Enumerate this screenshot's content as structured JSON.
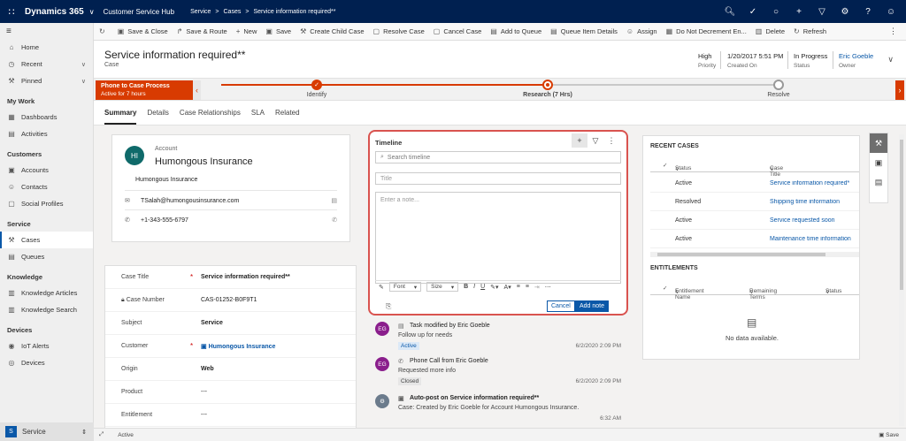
{
  "topbar": {
    "app_name": "Dynamics 365",
    "hub": "Customer Service Hub",
    "breadcrumb": [
      "Service",
      ">",
      "Cases",
      ">",
      "Service information required**"
    ],
    "icons": [
      "search-icon",
      "task-icon",
      "lightbulb-icon",
      "add-icon",
      "filter-icon",
      "gear-icon",
      "help-icon",
      "user-icon"
    ]
  },
  "sidebar": {
    "pinned_items": [
      {
        "icon": "home-icon",
        "label": "Home"
      },
      {
        "icon": "clock-icon",
        "label": "Recent"
      },
      {
        "icon": "pin-icon",
        "label": "Pinned"
      }
    ],
    "groups": [
      {
        "title": "My Work",
        "items": [
          {
            "label": "Dashboards"
          },
          {
            "label": "Activities"
          }
        ]
      },
      {
        "title": "Customers",
        "items": [
          {
            "label": "Accounts"
          },
          {
            "label": "Contacts"
          },
          {
            "label": "Social Profiles"
          }
        ]
      },
      {
        "title": "Service",
        "items": [
          {
            "label": "Cases"
          },
          {
            "label": "Queues"
          }
        ]
      },
      {
        "title": "Knowledge",
        "items": [
          {
            "label": "Knowledge Articles"
          },
          {
            "label": "Knowledge Search"
          }
        ]
      },
      {
        "title": "Devices",
        "items": [
          {
            "label": "IoT Alerts"
          },
          {
            "label": "Devices"
          }
        ]
      }
    ],
    "area_badge": "S",
    "area_label": "Service"
  },
  "commands": [
    "Save & Close",
    "Save & Route",
    "New",
    "Save",
    "Create Child Case",
    "Resolve Case",
    "Cancel Case",
    "Add to Queue",
    "Queue Item Details",
    "Assign",
    "Do Not Decrement En...",
    "Delete",
    "Refresh"
  ],
  "header": {
    "title": "Service information required**",
    "entity": "Case",
    "priority_value": "High",
    "priority_label": "Priority",
    "created_value": "1/20/2017 5:51 PM",
    "created_label": "Created On",
    "status_value": "In Progress",
    "status_label": "Status",
    "owner_value": "Eric Goeble",
    "owner_label": "Owner"
  },
  "bpf": {
    "process_name": "Phone to Case Process",
    "process_sub": "Active for 7 hours",
    "stages": [
      {
        "label": "Identify",
        "state": "done"
      },
      {
        "label": "Research  (7 Hrs)",
        "state": "active"
      },
      {
        "label": "Resolve",
        "state": "pending"
      }
    ]
  },
  "tabs": [
    "Summary",
    "Details",
    "Case Relationships",
    "SLA",
    "Related"
  ],
  "account": {
    "label": "Account",
    "initials": "HI",
    "name": "Humongous Insurance",
    "name_small": "Humongous Insurance",
    "email": "TSalah@humongousinsurance.com",
    "phone": "+1-343-555-6797"
  },
  "case_fields": [
    {
      "label": "Case Title",
      "required": "*",
      "value": "Service information required**",
      "style": "bold"
    },
    {
      "label": "Case Number",
      "required": "",
      "value": "CAS-01252-B0F9T1",
      "style": ""
    },
    {
      "label": "Subject",
      "required": "",
      "value": "Service",
      "style": "bold"
    },
    {
      "label": "Customer",
      "required": "*",
      "value": "Humongous Insurance",
      "style": "link"
    },
    {
      "label": "Origin",
      "required": "",
      "value": "Web",
      "style": "bold"
    },
    {
      "label": "Product",
      "required": "",
      "value": "---",
      "style": ""
    },
    {
      "label": "Entitlement",
      "required": "",
      "value": "---",
      "style": ""
    }
  ],
  "timeline": {
    "title": "Timeline",
    "search_placeholder": "Search timeline",
    "title_placeholder": "Title",
    "note_placeholder": "Enter a note...",
    "font_label": "Font",
    "size_label": "Size",
    "cancel_label": "Cancel",
    "add_label": "Add note",
    "activities": [
      {
        "initials": "EG",
        "color": "#8a1e8c",
        "icon": "task-icon",
        "title": "Task modified by Eric Goeble",
        "sub": "Follow up for needs",
        "tag": "Active",
        "tag_bg": "#dbe9f7",
        "tag_fg": "#0a58a8",
        "time": "6/2/2020 2:09 PM"
      },
      {
        "initials": "EG",
        "color": "#8a1e8c",
        "icon": "phone-icon",
        "title": "Phone Call from Eric Goeble",
        "sub": "Requested more info",
        "tag": "Closed",
        "tag_bg": "#e6e6e6",
        "tag_fg": "#444",
        "time": "6/2/2020 2:09 PM"
      },
      {
        "initials": "",
        "color": "#6b7b8c",
        "icon": "post-icon",
        "title": "Auto-post on Service information required**",
        "sub": "Case: Created by Eric Goeble for Account Humongous Insurance.",
        "tag": "",
        "tag_bg": "",
        "tag_fg": "",
        "time": "6:32 AM"
      }
    ]
  },
  "recent_cases": {
    "title": "RECENT CASES",
    "col_status": "Status",
    "col_title": "Case Title",
    "rows": [
      {
        "status": "Active",
        "title": "Service information required*"
      },
      {
        "status": "Resolved",
        "title": "Shipping time information"
      },
      {
        "status": "Active",
        "title": "Service requested soon"
      },
      {
        "status": "Active",
        "title": "Maintenance time information"
      }
    ]
  },
  "entitlements": {
    "title": "ENTITLEMENTS",
    "col_name": "Entitlement Name",
    "col_remaining": "Remaining Terms",
    "col_status": "Status",
    "empty_text": "No data available."
  },
  "statusbar": {
    "status": "Active",
    "save_label": "Save"
  },
  "colors": {
    "nav": "#002050",
    "accent": "#0a58a8",
    "bpf": "#d83b01",
    "required": "#c00000"
  }
}
